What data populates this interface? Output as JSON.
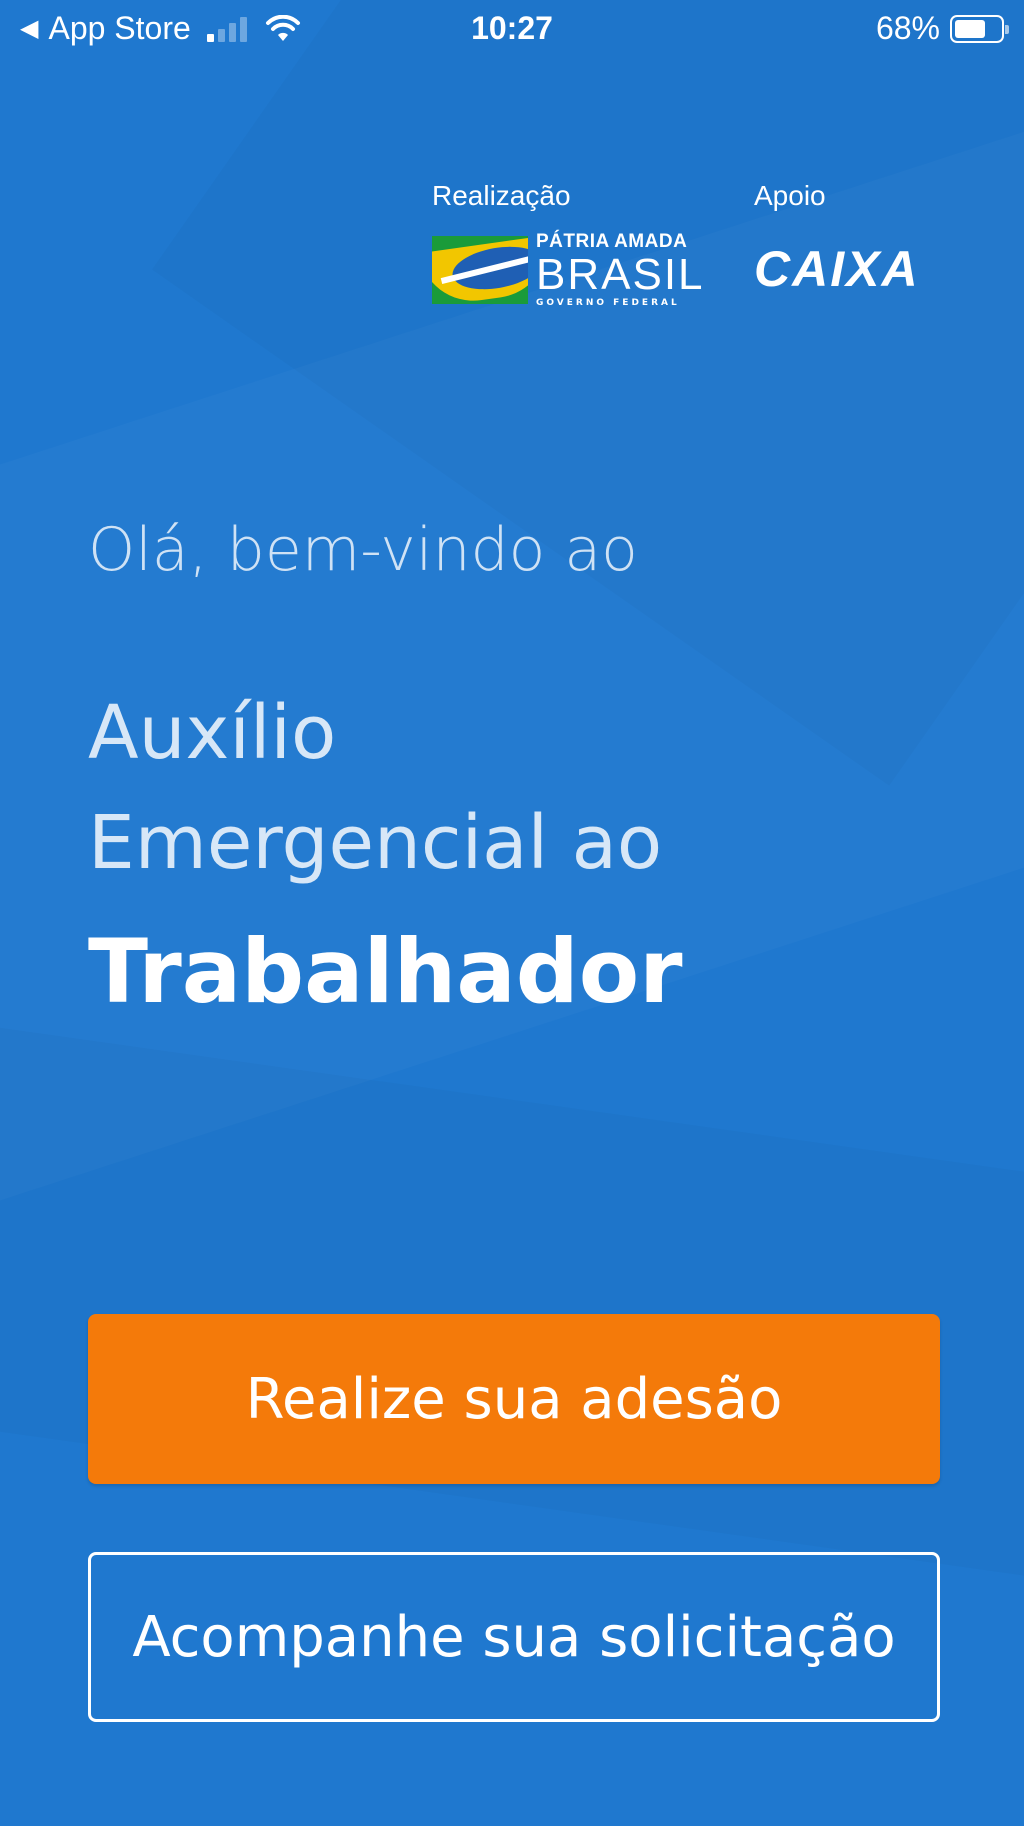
{
  "status_bar": {
    "back_app": "App Store",
    "back_icon": "back-triangle-icon",
    "time": "10:27",
    "battery_percent": "68%",
    "battery_level": 0.68
  },
  "sponsors": {
    "realizacao_label": "Realização",
    "patria_top": "PÁTRIA AMADA",
    "patria_brasil": "BRASIL",
    "patria_gov": "GOVERNO FEDERAL",
    "apoio_label": "Apoio",
    "caixa": "CAIXA"
  },
  "main": {
    "greeting": "Olá, bem-vindo ao",
    "title_line1": "Auxílio",
    "title_line2": "Emergencial ao",
    "title_line3": "Trabalhador"
  },
  "actions": {
    "primary_label": "Realize sua adesão",
    "secondary_label": "Acompanhe sua solicitação"
  },
  "colors": {
    "background": "#1f78cf",
    "primary_button": "#f47a0a",
    "text": "#ffffff"
  }
}
